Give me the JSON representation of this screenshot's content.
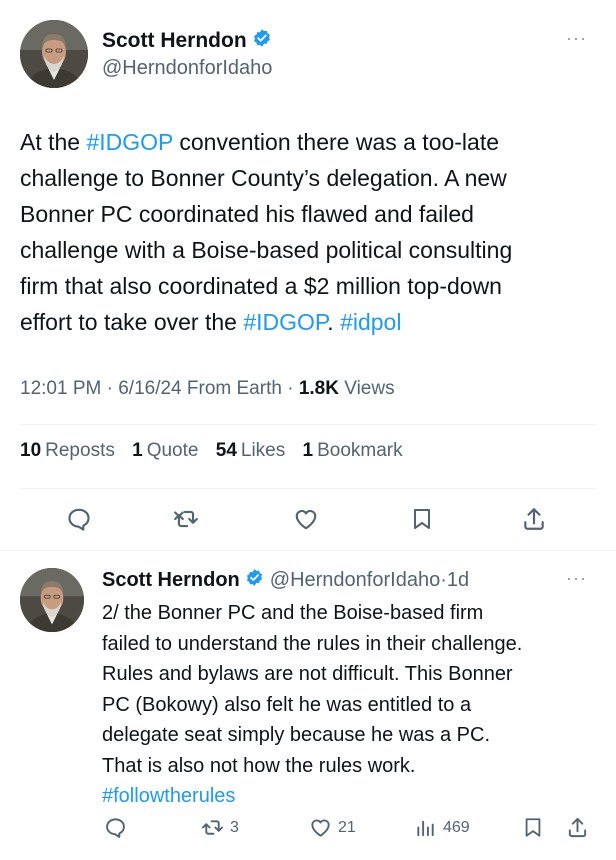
{
  "tweet": {
    "author_name": "Scott Herndon",
    "author_handle": "@HerndonforIdaho",
    "more_icon": "more-dots-icon",
    "lines": [
      [
        {
          "t": "At the "
        },
        {
          "t": "#IDGOP",
          "tag": true
        },
        {
          "t": " convention there was a too-late"
        }
      ],
      [
        {
          "t": "challenge to Bonner County’s delegation. A new"
        }
      ],
      [
        {
          "t": "Bonner PC coordinated his flawed and failed"
        }
      ],
      [
        {
          "t": "challenge with a Boise-based political consulting"
        }
      ],
      [
        {
          "t": "firm that also coordinated a $2 million top-down"
        }
      ],
      [
        {
          "t": "effort to take over the "
        },
        {
          "t": "#IDGOP",
          "tag": true
        },
        {
          "t": ". "
        },
        {
          "t": "#idpol",
          "tag": true
        }
      ]
    ],
    "meta": {
      "time": "12:01 PM",
      "date": "6/16/24",
      "source": "From Earth",
      "views_count": "1.8K",
      "views_label": "Views"
    },
    "stats": {
      "reposts_count": "10",
      "reposts_label": "Reposts",
      "quotes_count": "1",
      "quotes_label": "Quote",
      "likes_count": "54",
      "likes_label": "Likes",
      "bookmarks_count": "1",
      "bookmarks_label": "Bookmark"
    }
  },
  "reply": {
    "author_name": "Scott Herndon",
    "author_handle": "@HerndonforIdaho",
    "time_ago": "1d",
    "lines": [
      [
        {
          "t": "2/ the Bonner PC and the Boise-based firm"
        }
      ],
      [
        {
          "t": "failed to understand the rules in their challenge."
        }
      ],
      [
        {
          "t": "Rules and bylaws are not difficult. This Bonner"
        }
      ],
      [
        {
          "t": "PC (Bokowy) also felt he was entitled to a"
        }
      ],
      [
        {
          "t": "delegate seat simply because he was a PC."
        }
      ],
      [
        {
          "t": "That is also not how the rules work."
        }
      ],
      [
        {
          "t": "#followtherules",
          "tag": true
        }
      ]
    ],
    "actions": {
      "reposts": "3",
      "likes": "21",
      "views": "469"
    }
  },
  "colors": {
    "accent": "#1d9bf0",
    "secondary_text": "#536471",
    "primary_text": "#0f1419"
  }
}
